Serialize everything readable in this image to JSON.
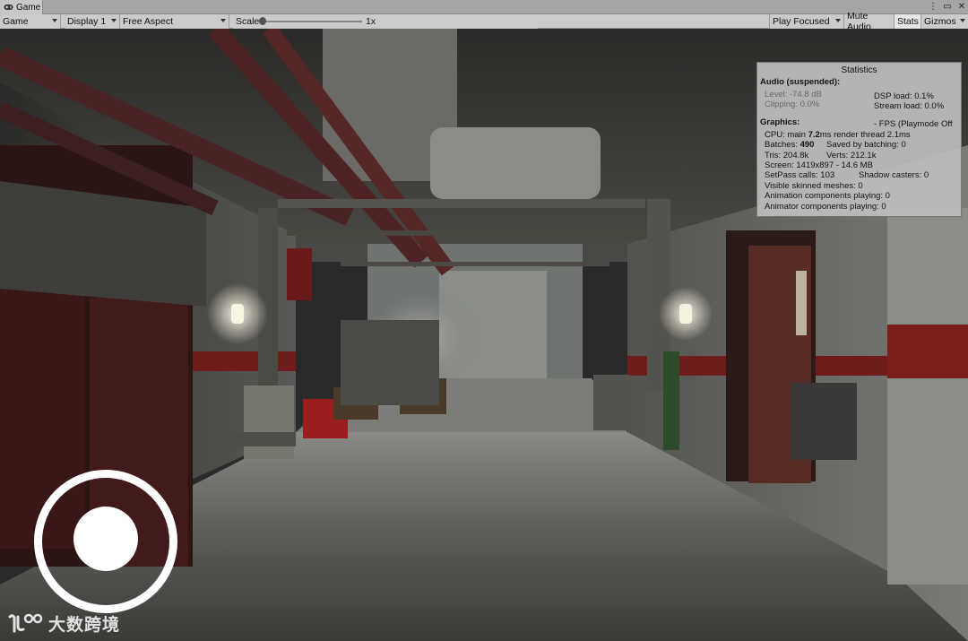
{
  "window": {
    "tab_label": "Game",
    "tab_icon": "gamepad-icon",
    "controls": [
      "⋮",
      "▭",
      "✕"
    ]
  },
  "toolbar": {
    "game_mode": "Game",
    "display": "Display 1",
    "aspect": "Free Aspect",
    "scale_label": "Scale",
    "scale_value": "1x",
    "play_focused": "Play Focused",
    "mute_audio": "Mute Audio",
    "stats": "Stats",
    "gizmos": "Gizmos"
  },
  "stats": {
    "title": "Statistics",
    "audio_header": "Audio (suspended):",
    "level": "Level: -74.8 dB",
    "clipping": "Clipping: 0.0%",
    "dsp_load": "DSP load: 0.1%",
    "stream_load": "Stream load: 0.0%",
    "graphics_header": "Graphics:",
    "fps": "- FPS (Playmode Off",
    "cpu_prefix": "CPU: main",
    "cpu_main": "7.2",
    "cpu_suffix": "ms  render thread 2.1ms",
    "batches_prefix": "Batches:",
    "batches": "490",
    "saved_batching": "Saved by batching: 0",
    "tris": "Tris: 204.8k",
    "verts": "Verts: 212.1k",
    "screen": "Screen: 1419x897 - 14.6 MB",
    "setpass": "SetPass calls: 103",
    "shadow_casters": "Shadow casters: 0",
    "skinned_meshes": "Visible skinned meshes: 0",
    "animation_components": "Animation components playing: 0",
    "animator_components": "Animator components playing: 0"
  },
  "watermark": {
    "text": "大数跨境",
    "logo_icon": "brand-logo-icon"
  },
  "colors": {
    "toolbar_bg": "#cbcbcb",
    "stats_bg": "#bebebe",
    "joystick": "#ffffff",
    "stripe_red": "#7a1e1e"
  }
}
